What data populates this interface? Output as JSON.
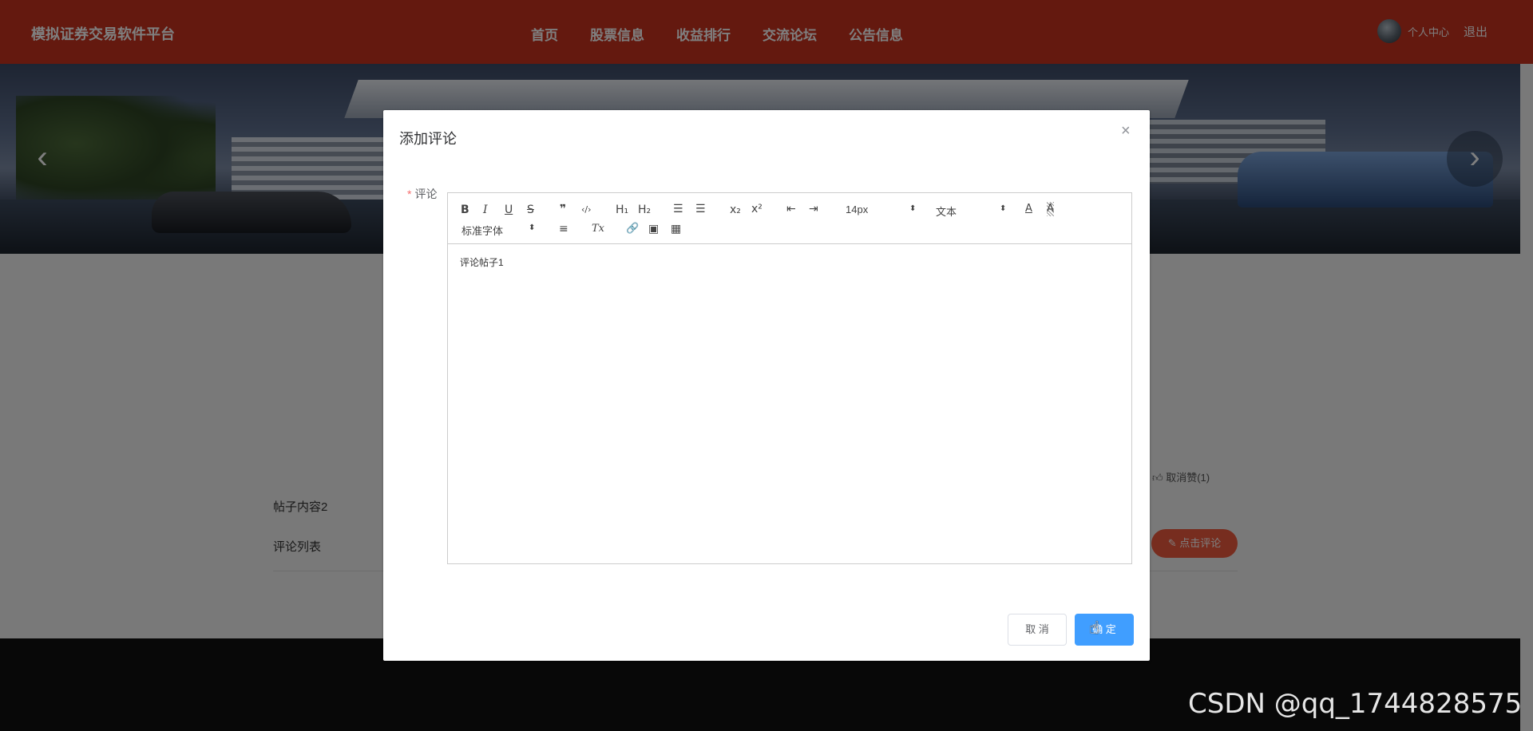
{
  "header": {
    "brand": "模拟证券交易软件平台",
    "nav": [
      "首页",
      "股票信息",
      "收益排行",
      "交流论坛",
      "公告信息"
    ],
    "user_center": "个人中心",
    "logout": "退出"
  },
  "banner": {
    "prev_icon": "‹",
    "next_icon": "›"
  },
  "page": {
    "post_content": "帖子内容2",
    "comment_list_label": "评论列表",
    "like_text": "取消赞(1)",
    "comment_button": "点击评论"
  },
  "dialog": {
    "title": "添加评论",
    "close": "×",
    "field_label": "评论",
    "required_mark": "*",
    "toolbar": {
      "bold": "B",
      "italic": "I",
      "underline": "U",
      "strike": "S",
      "quote": "❞",
      "code": "‹/›",
      "h1": "H₁",
      "h2": "H₂",
      "ordered_list": "☰",
      "bullet_list": "☰",
      "subscript": "x₂",
      "superscript": "x²",
      "outdent": "⇤",
      "indent": "⇥",
      "size_select": "14px",
      "header_select": "文本",
      "font_color": "A",
      "background_color": "A",
      "font_select": "标准字体",
      "align": "≡",
      "clean": "Tx",
      "link": "🔗",
      "image": "▣",
      "video": "▦"
    },
    "editor_content": "评论帖子1",
    "cancel_button": "取 消",
    "confirm_button": "确 定"
  },
  "watermark": "CSDN @qq_1744828575"
}
